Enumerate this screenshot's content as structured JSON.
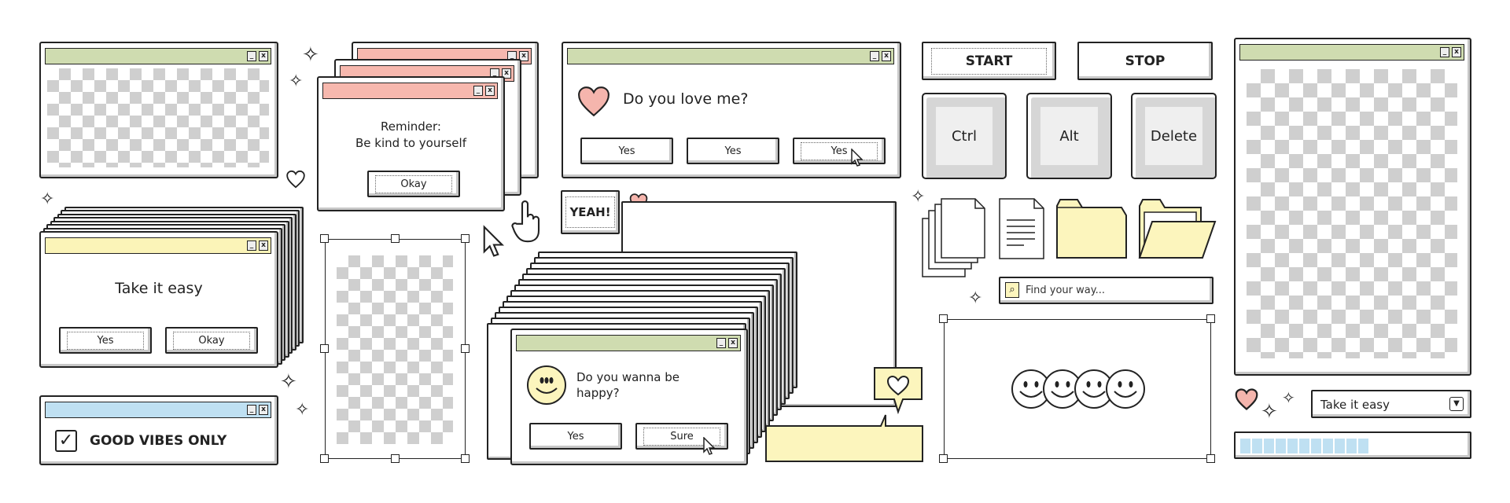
{
  "window_controls": {
    "minimize": "_",
    "close": "x"
  },
  "colors": {
    "green_title": "#cfdcb0",
    "pink_title": "#f7b8ae",
    "yellow_title": "#fbf4b8",
    "blue_title": "#bfe0f2",
    "checker_gray": "#cfcfcf",
    "heart_pink": "#f5b5ad",
    "yellow": "#fcf5bd",
    "progress_blue": "#bfe0f2"
  },
  "reminder": {
    "line1": "Reminder:",
    "line2": "Be kind to yourself",
    "ok_label": "Okay"
  },
  "love": {
    "message": "Do you love me?",
    "buttons": [
      "Yes",
      "Yes",
      "Yes"
    ]
  },
  "take_easy": {
    "message": "Take it easy",
    "buttons": [
      "Yes",
      "Okay"
    ]
  },
  "good_vibes": {
    "label": "GOOD VIBES ONLY",
    "checked": true,
    "check_glyph": "✓"
  },
  "yeah": {
    "label": "YEAH!"
  },
  "happy": {
    "message": "Do you wanna be happy?",
    "buttons": [
      "Yes",
      "Sure"
    ]
  },
  "controls": {
    "start": "START",
    "stop": "STOP"
  },
  "keys": [
    "Ctrl",
    "Alt",
    "Delete"
  ],
  "search": {
    "placeholder": "Find your way..."
  },
  "dropdown": {
    "value": "Take it easy"
  },
  "progress": {
    "value": 0.6
  },
  "icons": [
    "documents-stack-icon",
    "document-icon",
    "folder-icon",
    "open-folder-icon",
    "heart-icon",
    "sparkle-icon",
    "cursor-arrow-icon",
    "hand-pointer-icon",
    "smiley-icon"
  ]
}
